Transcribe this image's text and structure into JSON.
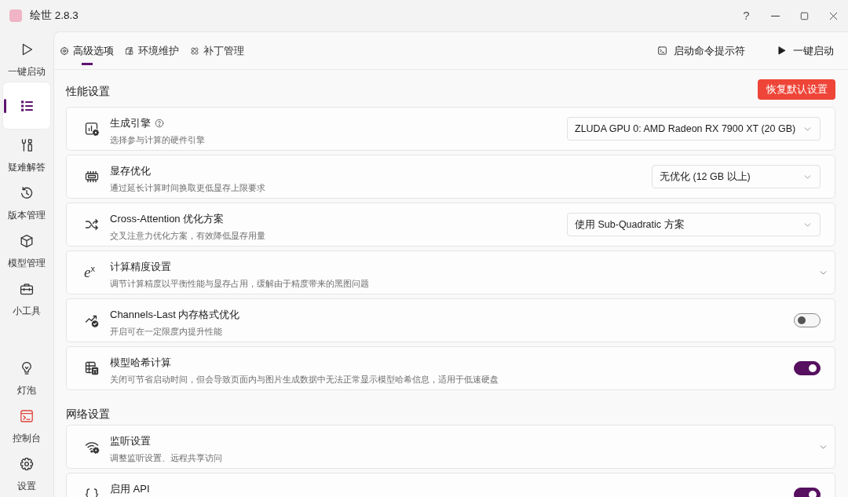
{
  "window": {
    "title": "绘世 2.8.3",
    "help_button": "?"
  },
  "sidebar": {
    "items": [
      {
        "label": "一键启动",
        "selected": false
      },
      {
        "selected": true
      },
      {
        "label": "疑难解答",
        "selected": false
      },
      {
        "label": "版本管理",
        "selected": false
      },
      {
        "label": "模型管理",
        "selected": false
      },
      {
        "label": "小工具",
        "selected": false
      }
    ],
    "bottom_items": [
      {
        "label": "灯泡",
        "alert": false
      },
      {
        "label": "控制台",
        "alert": true
      },
      {
        "label": "设置",
        "alert": false
      }
    ]
  },
  "tabs": [
    {
      "label": "高级选项",
      "selected": true
    },
    {
      "label": "环境维护",
      "selected": false
    },
    {
      "label": "补丁管理",
      "selected": false
    }
  ],
  "header_actions": [
    {
      "label": "启动命令提示符"
    },
    {
      "label": "一键启动"
    }
  ],
  "sections": [
    {
      "title": "性能设置",
      "reset_button": "恢复默认设置",
      "settings": [
        {
          "kind": "select",
          "title": "生成引擎",
          "help": true,
          "description": "选择参与计算的硬件引擎",
          "value": "ZLUDA GPU 0: AMD Radeon RX 7900 XT (20 GB)"
        },
        {
          "kind": "select",
          "title": "显存优化",
          "help": false,
          "description": "通过延长计算时间换取更低显存上限要求",
          "value": "无优化 (12 GB 以上)"
        },
        {
          "kind": "select",
          "title": "Cross-Attention 优化方案",
          "help": false,
          "description": "交叉注意力优化方案，有效降低显存用量",
          "value": "使用 Sub-Quadratic 方案"
        },
        {
          "kind": "expander",
          "symbol": "e$^{x}$",
          "title": "计算精度设置",
          "help": false,
          "description": "调节计算精度以平衡性能与显存占用，缓解由于精度带来的黑图问题",
          "expanded": false
        },
        {
          "kind": "toggle",
          "title": "Channels-Last 内存格式优化",
          "help": false,
          "description": "开启可在一定限度内提升性能",
          "on": false
        },
        {
          "kind": "toggle",
          "title": "模型哈希计算",
          "help": false,
          "description": "关闭可节省启动时间，但会导致页面内与图片生成数据中无法正常显示模型哈希信息，适用于低速硬盘",
          "on": true
        }
      ]
    },
    {
      "title": "网络设置",
      "settings": [
        {
          "kind": "expander",
          "title": "监听设置",
          "help": false,
          "description": "调整监听设置、远程共享访问",
          "expanded": false
        },
        {
          "kind": "toggle",
          "title": "启用 API",
          "help": false,
          "on": true
        }
      ]
    }
  ]
}
